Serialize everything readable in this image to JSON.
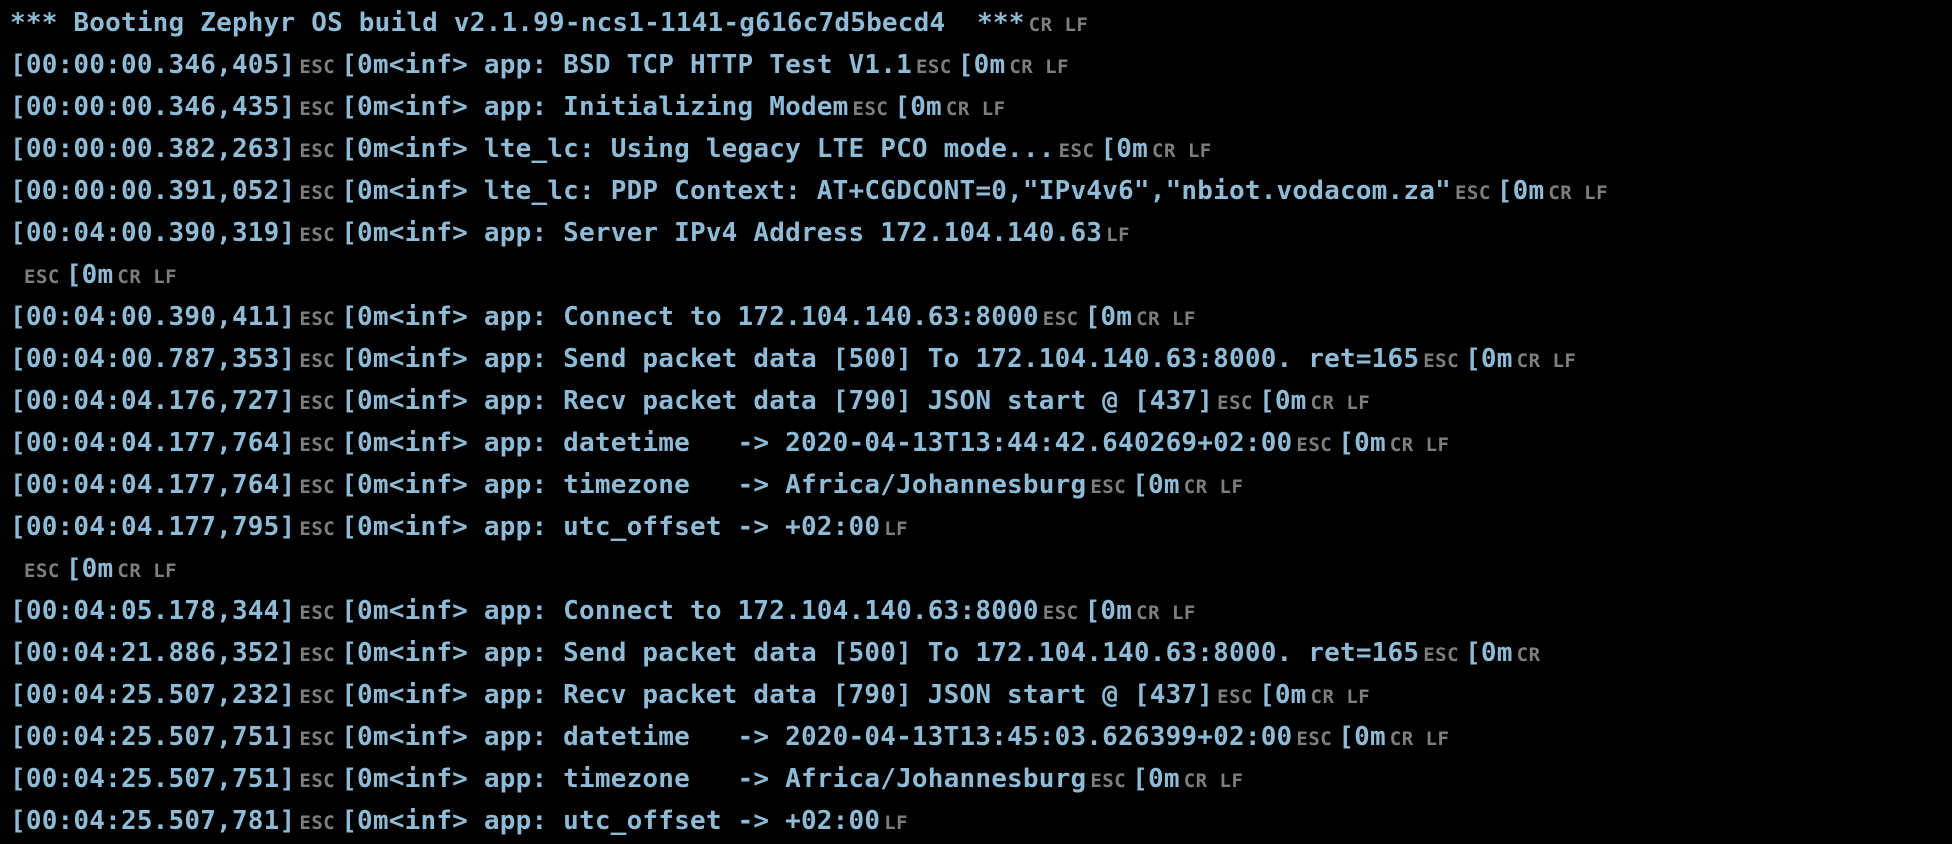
{
  "terminal": {
    "colors": {
      "background": "#000000",
      "text": "#8fbbd6",
      "control": "#7e7e7e"
    },
    "lines": [
      {
        "segments": [
          {
            "t": "txt",
            "v": "*** Booting Zephyr OS build v2.1.99-ncs1-1141-g616c7d5becd4  ***"
          },
          {
            "t": "ctrl",
            "v": "CR LF"
          }
        ]
      },
      {
        "segments": [
          {
            "t": "txt",
            "v": "[00:00:00.346,405]"
          },
          {
            "t": "ctrl",
            "v": "ESC"
          },
          {
            "t": "txt",
            "v": "[0m<inf> app: BSD TCP HTTP Test V1.1"
          },
          {
            "t": "ctrl",
            "v": "ESC"
          },
          {
            "t": "txt",
            "v": "[0m"
          },
          {
            "t": "ctrl",
            "v": "CR LF"
          }
        ]
      },
      {
        "segments": [
          {
            "t": "txt",
            "v": "[00:00:00.346,435]"
          },
          {
            "t": "ctrl",
            "v": "ESC"
          },
          {
            "t": "txt",
            "v": "[0m<inf> app: Initializing Modem"
          },
          {
            "t": "ctrl",
            "v": "ESC"
          },
          {
            "t": "txt",
            "v": "[0m"
          },
          {
            "t": "ctrl",
            "v": "CR LF"
          }
        ]
      },
      {
        "segments": [
          {
            "t": "txt",
            "v": "[00:00:00.382,263]"
          },
          {
            "t": "ctrl",
            "v": "ESC"
          },
          {
            "t": "txt",
            "v": "[0m<inf> lte_lc: Using legacy LTE PCO mode..."
          },
          {
            "t": "ctrl",
            "v": "ESC"
          },
          {
            "t": "txt",
            "v": "[0m"
          },
          {
            "t": "ctrl",
            "v": "CR LF"
          }
        ]
      },
      {
        "segments": [
          {
            "t": "txt",
            "v": "[00:00:00.391,052]"
          },
          {
            "t": "ctrl",
            "v": "ESC"
          },
          {
            "t": "txt",
            "v": "[0m<inf> lte_lc: PDP Context: AT+CGDCONT=0,\"IPv4v6\",\"nbiot.vodacom.za\""
          },
          {
            "t": "ctrl",
            "v": "ESC"
          },
          {
            "t": "txt",
            "v": "[0m"
          },
          {
            "t": "ctrl",
            "v": "CR LF"
          }
        ]
      },
      {
        "segments": [
          {
            "t": "txt",
            "v": "[00:04:00.390,319]"
          },
          {
            "t": "ctrl",
            "v": "ESC"
          },
          {
            "t": "txt",
            "v": "[0m<inf> app: Server IPv4 Address 172.104.140.63"
          },
          {
            "t": "ctrl",
            "v": "LF"
          }
        ]
      },
      {
        "segments": [
          {
            "t": "ctrl-lead",
            "v": "ESC"
          },
          {
            "t": "txt",
            "v": "[0m"
          },
          {
            "t": "ctrl",
            "v": "CR LF"
          }
        ]
      },
      {
        "segments": [
          {
            "t": "txt",
            "v": "[00:04:00.390,411]"
          },
          {
            "t": "ctrl",
            "v": "ESC"
          },
          {
            "t": "txt",
            "v": "[0m<inf> app: Connect to 172.104.140.63:8000"
          },
          {
            "t": "ctrl",
            "v": "ESC"
          },
          {
            "t": "txt",
            "v": "[0m"
          },
          {
            "t": "ctrl",
            "v": "CR LF"
          }
        ]
      },
      {
        "segments": [
          {
            "t": "txt",
            "v": "[00:04:00.787,353]"
          },
          {
            "t": "ctrl",
            "v": "ESC"
          },
          {
            "t": "txt",
            "v": "[0m<inf> app: Send packet data [500] To 172.104.140.63:8000. ret=165"
          },
          {
            "t": "ctrl",
            "v": "ESC"
          },
          {
            "t": "txt",
            "v": "[0m"
          },
          {
            "t": "ctrl",
            "v": "CR LF"
          }
        ]
      },
      {
        "segments": [
          {
            "t": "txt",
            "v": "[00:04:04.176,727]"
          },
          {
            "t": "ctrl",
            "v": "ESC"
          },
          {
            "t": "txt",
            "v": "[0m<inf> app: Recv packet data [790] JSON start @ [437]"
          },
          {
            "t": "ctrl",
            "v": "ESC"
          },
          {
            "t": "txt",
            "v": "[0m"
          },
          {
            "t": "ctrl",
            "v": "CR LF"
          }
        ]
      },
      {
        "segments": [
          {
            "t": "txt",
            "v": "[00:04:04.177,764]"
          },
          {
            "t": "ctrl",
            "v": "ESC"
          },
          {
            "t": "txt",
            "v": "[0m<inf> app: datetime   -> 2020-04-13T13:44:42.640269+02:00"
          },
          {
            "t": "ctrl",
            "v": "ESC"
          },
          {
            "t": "txt",
            "v": "[0m"
          },
          {
            "t": "ctrl",
            "v": "CR LF"
          }
        ]
      },
      {
        "segments": [
          {
            "t": "txt",
            "v": "[00:04:04.177,764]"
          },
          {
            "t": "ctrl",
            "v": "ESC"
          },
          {
            "t": "txt",
            "v": "[0m<inf> app: timezone   -> Africa/Johannesburg"
          },
          {
            "t": "ctrl",
            "v": "ESC"
          },
          {
            "t": "txt",
            "v": "[0m"
          },
          {
            "t": "ctrl",
            "v": "CR LF"
          }
        ]
      },
      {
        "segments": [
          {
            "t": "txt",
            "v": "[00:04:04.177,795]"
          },
          {
            "t": "ctrl",
            "v": "ESC"
          },
          {
            "t": "txt",
            "v": "[0m<inf> app: utc_offset -> +02:00"
          },
          {
            "t": "ctrl",
            "v": "LF"
          }
        ]
      },
      {
        "segments": [
          {
            "t": "ctrl-lead",
            "v": "ESC"
          },
          {
            "t": "txt",
            "v": "[0m"
          },
          {
            "t": "ctrl",
            "v": "CR LF"
          }
        ]
      },
      {
        "segments": [
          {
            "t": "txt",
            "v": "[00:04:05.178,344]"
          },
          {
            "t": "ctrl",
            "v": "ESC"
          },
          {
            "t": "txt",
            "v": "[0m<inf> app: Connect to 172.104.140.63:8000"
          },
          {
            "t": "ctrl",
            "v": "ESC"
          },
          {
            "t": "txt",
            "v": "[0m"
          },
          {
            "t": "ctrl",
            "v": "CR LF"
          }
        ]
      },
      {
        "segments": [
          {
            "t": "txt",
            "v": "[00:04:21.886,352]"
          },
          {
            "t": "ctrl",
            "v": "ESC"
          },
          {
            "t": "txt",
            "v": "[0m<inf> app: Send packet data [500] To 172.104.140.63:8000. ret=165"
          },
          {
            "t": "ctrl",
            "v": "ESC"
          },
          {
            "t": "txt",
            "v": "[0m"
          },
          {
            "t": "ctrl",
            "v": "CR"
          }
        ]
      },
      {
        "segments": [
          {
            "t": "txt",
            "v": "[00:04:25.507,232]"
          },
          {
            "t": "ctrl",
            "v": "ESC"
          },
          {
            "t": "txt",
            "v": "[0m<inf> app: Recv packet data [790] JSON start @ [437]"
          },
          {
            "t": "ctrl",
            "v": "ESC"
          },
          {
            "t": "txt",
            "v": "[0m"
          },
          {
            "t": "ctrl",
            "v": "CR LF"
          }
        ]
      },
      {
        "segments": [
          {
            "t": "txt",
            "v": "[00:04:25.507,751]"
          },
          {
            "t": "ctrl",
            "v": "ESC"
          },
          {
            "t": "txt",
            "v": "[0m<inf> app: datetime   -> 2020-04-13T13:45:03.626399+02:00"
          },
          {
            "t": "ctrl",
            "v": "ESC"
          },
          {
            "t": "txt",
            "v": "[0m"
          },
          {
            "t": "ctrl",
            "v": "CR LF"
          }
        ]
      },
      {
        "segments": [
          {
            "t": "txt",
            "v": "[00:04:25.507,751]"
          },
          {
            "t": "ctrl",
            "v": "ESC"
          },
          {
            "t": "txt",
            "v": "[0m<inf> app: timezone   -> Africa/Johannesburg"
          },
          {
            "t": "ctrl",
            "v": "ESC"
          },
          {
            "t": "txt",
            "v": "[0m"
          },
          {
            "t": "ctrl",
            "v": "CR LF"
          }
        ]
      },
      {
        "segments": [
          {
            "t": "txt",
            "v": "[00:04:25.507,781]"
          },
          {
            "t": "ctrl",
            "v": "ESC"
          },
          {
            "t": "txt",
            "v": "[0m<inf> app: utc_offset -> +02:00"
          },
          {
            "t": "ctrl",
            "v": "LF"
          }
        ]
      }
    ]
  }
}
